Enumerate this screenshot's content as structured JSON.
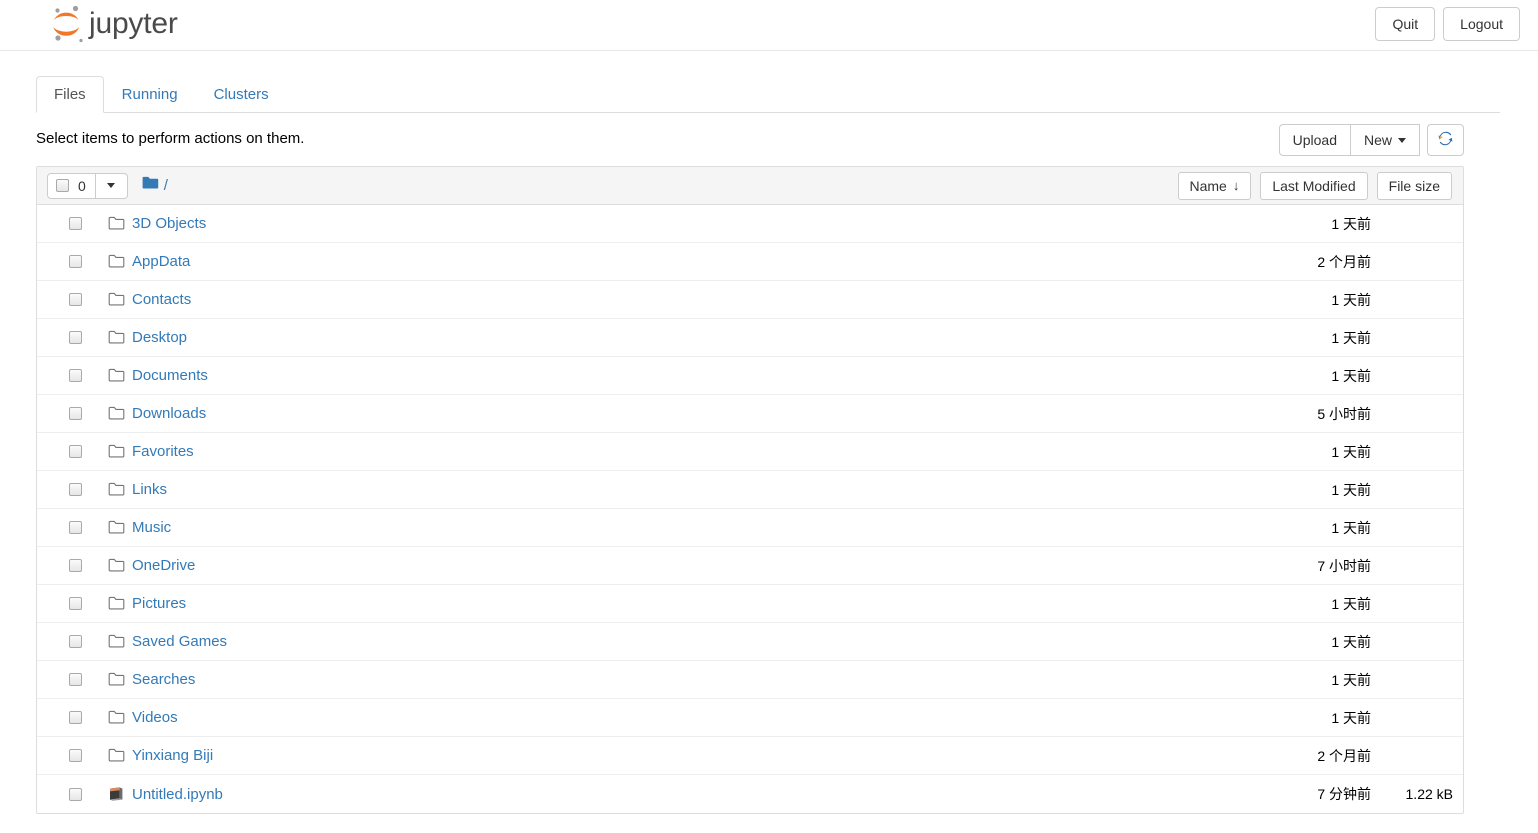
{
  "header": {
    "brand": "jupyter",
    "logo_icon": "jupyter-logo",
    "quit_label": "Quit",
    "logout_label": "Logout"
  },
  "tabs": [
    {
      "label": "Files",
      "active": true
    },
    {
      "label": "Running",
      "active": false
    },
    {
      "label": "Clusters",
      "active": false
    }
  ],
  "actions": {
    "hint": "Select items to perform actions on them.",
    "upload_label": "Upload",
    "new_label": "New",
    "new_caret_icon": "chevron-down-icon",
    "refresh_icon": "refresh-icon"
  },
  "list_header": {
    "select_all_checkbox": "checkbox-unchecked",
    "selected_count": "0",
    "select_menu_caret_icon": "chevron-down-icon",
    "breadcrumb_folder_icon": "folder-filled-icon",
    "breadcrumb_path": "/",
    "sort": {
      "name_label": "Name",
      "name_sort_arrow": "↓",
      "last_modified_label": "Last Modified",
      "file_size_label": "File size"
    }
  },
  "files": [
    {
      "name": "3D Objects",
      "icon": "folder-icon",
      "modified": "1 天前",
      "size": ""
    },
    {
      "name": "AppData",
      "icon": "folder-icon",
      "modified": "2 个月前",
      "size": ""
    },
    {
      "name": "Contacts",
      "icon": "folder-icon",
      "modified": "1 天前",
      "size": ""
    },
    {
      "name": "Desktop",
      "icon": "folder-icon",
      "modified": "1 天前",
      "size": ""
    },
    {
      "name": "Documents",
      "icon": "folder-icon",
      "modified": "1 天前",
      "size": ""
    },
    {
      "name": "Downloads",
      "icon": "folder-icon",
      "modified": "5 小时前",
      "size": ""
    },
    {
      "name": "Favorites",
      "icon": "folder-icon",
      "modified": "1 天前",
      "size": ""
    },
    {
      "name": "Links",
      "icon": "folder-icon",
      "modified": "1 天前",
      "size": ""
    },
    {
      "name": "Music",
      "icon": "folder-icon",
      "modified": "1 天前",
      "size": ""
    },
    {
      "name": "OneDrive",
      "icon": "folder-icon",
      "modified": "7 小时前",
      "size": ""
    },
    {
      "name": "Pictures",
      "icon": "folder-icon",
      "modified": "1 天前",
      "size": ""
    },
    {
      "name": "Saved Games",
      "icon": "folder-icon",
      "modified": "1 天前",
      "size": ""
    },
    {
      "name": "Searches",
      "icon": "folder-icon",
      "modified": "1 天前",
      "size": ""
    },
    {
      "name": "Videos",
      "icon": "folder-icon",
      "modified": "1 天前",
      "size": ""
    },
    {
      "name": "Yinxiang Biji",
      "icon": "folder-icon",
      "modified": "2 个月前",
      "size": ""
    },
    {
      "name": "Untitled.ipynb",
      "icon": "notebook-icon",
      "modified": "7 分钟前",
      "size": "1.22 kB"
    }
  ],
  "colors": {
    "link": "#337ab7",
    "logo_orange": "#f37726",
    "logo_gray": "#9e9e9e",
    "folder_blue": "#337ab7",
    "border": "#dddddd",
    "header_bg": "#f5f5f5"
  }
}
